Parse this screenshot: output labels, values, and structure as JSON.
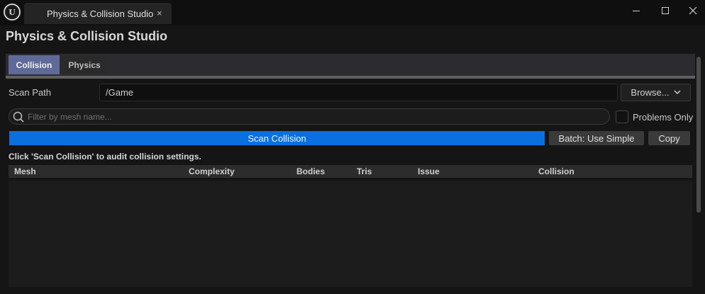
{
  "window": {
    "tab_title": "Physics & Collision Studio",
    "close_glyph": "×"
  },
  "page": {
    "title": "Physics & Collision Studio"
  },
  "tabs": [
    {
      "label": "Collision",
      "active": true
    },
    {
      "label": "Physics",
      "active": false
    }
  ],
  "scan": {
    "label": "Scan Path",
    "path_value": "/Game",
    "browse_label": "Browse..."
  },
  "filter": {
    "placeholder": "Filter by mesh name...",
    "problems_only_label": "Problems Only"
  },
  "actions": {
    "scan_label": "Scan Collision",
    "batch_label": "Batch: Use Simple",
    "copy_label": "Copy"
  },
  "hint": "Click 'Scan Collision' to audit collision settings.",
  "table": {
    "columns": [
      "Mesh",
      "Complexity",
      "Bodies",
      "Tris",
      "Issue",
      "Collision"
    ],
    "rows": []
  },
  "colors": {
    "accent": "#0a70e0",
    "active_tab": "#606a98"
  }
}
